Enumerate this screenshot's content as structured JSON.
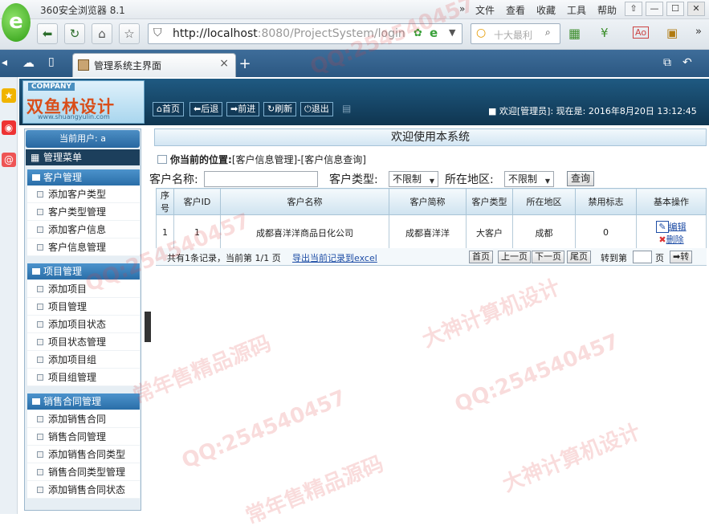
{
  "browser": {
    "window_title": "360安全浏览器 8.1",
    "menu": [
      "文件",
      "查看",
      "收藏",
      "工具",
      "帮助"
    ],
    "window_buttons": [
      "⇧",
      "—",
      "☐",
      "✕"
    ],
    "url_host": "http://localhost",
    "url_rest": ":8080/ProjectSystem/login",
    "search_placeholder": "十大最利",
    "tab_title": "管理系统主界面",
    "tab_close": "×",
    "new_tab": "+"
  },
  "header": {
    "company": "COMPANY",
    "brand": "双鱼林设计",
    "brand_url": "www.shuangyulin.com",
    "buttons": {
      "home": "首页",
      "back": "后退",
      "forward": "前进",
      "refresh": "刷新",
      "logout": "退出"
    },
    "welcome": "■ 欢迎[管理员]:    现在是: 2016年8月20日 13:12:45"
  },
  "sidebar": {
    "current_user": "当前用户: a",
    "menu_title": "管理菜单",
    "sections": [
      {
        "title": "客户管理",
        "items": [
          "添加客户类型",
          "客户类型管理",
          "添加客户信息",
          "客户信息管理"
        ]
      },
      {
        "title": "项目管理",
        "items": [
          "添加项目",
          "项目管理",
          "添加项目状态",
          "项目状态管理",
          "添加项目组",
          "项目组管理"
        ]
      },
      {
        "title": "销售合同管理",
        "items": [
          "添加销售合同",
          "销售合同管理",
          "添加销售合同类型",
          "销售合同类型管理",
          "添加销售合同状态"
        ]
      }
    ]
  },
  "main": {
    "title": "欢迎使用本系统",
    "location_label": "你当前的位置:",
    "location_path": "[客户信息管理]-[客户信息查询]",
    "search": {
      "name_label": "客户名称:",
      "name_value": "",
      "type_label": "客户类型:",
      "type_value": "不限制",
      "area_label": "所在地区:",
      "area_value": "不限制",
      "query_button": "查询"
    },
    "table": {
      "headers": [
        "序号",
        "客户ID",
        "客户名称",
        "客户简称",
        "客户类型",
        "所在地区",
        "禁用标志",
        "基本操作"
      ],
      "rows": [
        {
          "seq": "1",
          "id": "1",
          "name": "成都喜洋洋商品日化公司",
          "short": "成都喜洋洋",
          "type": "大客户",
          "area": "成都",
          "flag": "0",
          "edit": "编辑",
          "delete": "删除"
        }
      ]
    },
    "pager": {
      "info": "共有1条记录，当前第 1/1 页",
      "export": "导出当前记录到excel",
      "first": "首页",
      "prev": "上一页",
      "next": "下一页",
      "last": "尾页",
      "goto_label": "转到第",
      "page_unit": "页",
      "go_button": "➡转"
    }
  },
  "watermarks": [
    "QQ:254540457",
    "大神计算机设计",
    "常年售精品源码",
    "QQ:254540457",
    "大神计算机设计",
    "常年售精品源码",
    "QQ:254540457",
    "QQ:254540457"
  ]
}
